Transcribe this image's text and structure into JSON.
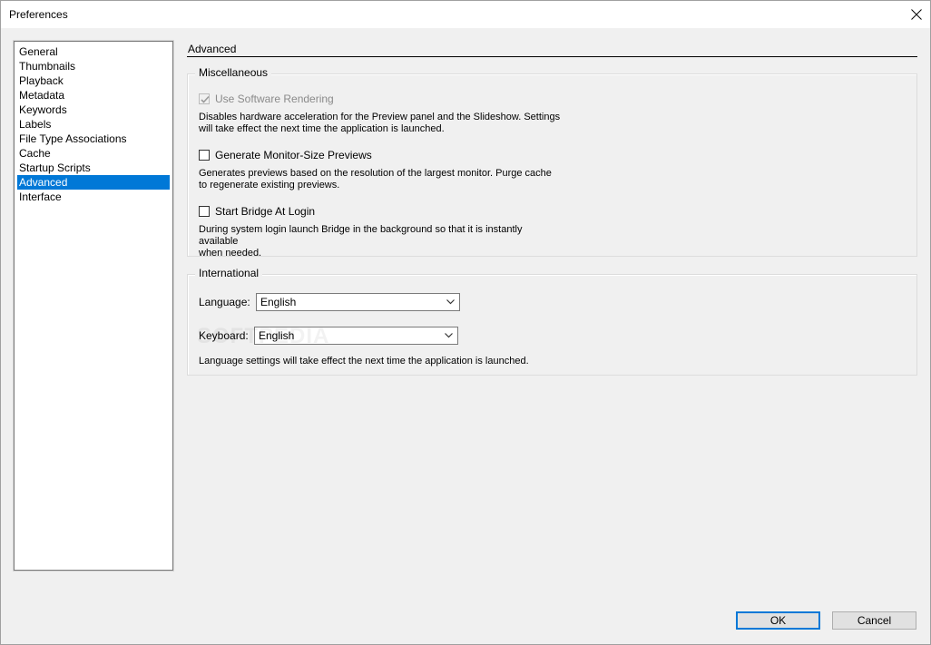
{
  "window": {
    "title": "Preferences"
  },
  "sidebar": {
    "items": [
      {
        "label": "General",
        "selected": false
      },
      {
        "label": "Thumbnails",
        "selected": false
      },
      {
        "label": "Playback",
        "selected": false
      },
      {
        "label": "Metadata",
        "selected": false
      },
      {
        "label": "Keywords",
        "selected": false
      },
      {
        "label": "Labels",
        "selected": false
      },
      {
        "label": "File Type Associations",
        "selected": false
      },
      {
        "label": "Cache",
        "selected": false
      },
      {
        "label": "Startup Scripts",
        "selected": false
      },
      {
        "label": "Advanced",
        "selected": true
      },
      {
        "label": "Interface",
        "selected": false
      }
    ]
  },
  "main": {
    "section_title": "Advanced",
    "misc": {
      "legend": "Miscellaneous",
      "options": [
        {
          "label": "Use Software Rendering",
          "checked": true,
          "disabled": true,
          "description_lines": [
            "Disables hardware acceleration for the Preview panel and the Slideshow. Settings",
            "will take effect the next time the application is launched."
          ]
        },
        {
          "label": "Generate Monitor-Size Previews",
          "checked": false,
          "disabled": false,
          "description_lines": [
            "Generates previews based on the resolution of the largest monitor.  Purge cache",
            "to regenerate existing previews."
          ]
        },
        {
          "label": "Start Bridge At Login",
          "checked": false,
          "disabled": false,
          "description_lines": [
            "During system login launch Bridge in the background so that it is instantly available",
            "when needed."
          ]
        }
      ]
    },
    "intl": {
      "legend": "International",
      "language_label": "Language:",
      "language_value": "English",
      "keyboard_label": "Keyboard:",
      "keyboard_value": "English",
      "note": "Language settings will take effect the next time the application is launched."
    },
    "watermark": "SOFTPEDIA"
  },
  "footer": {
    "ok_label": "OK",
    "cancel_label": "Cancel"
  },
  "colors": {
    "selection": "#0078d7",
    "window_bg": "#f0f0f0"
  }
}
